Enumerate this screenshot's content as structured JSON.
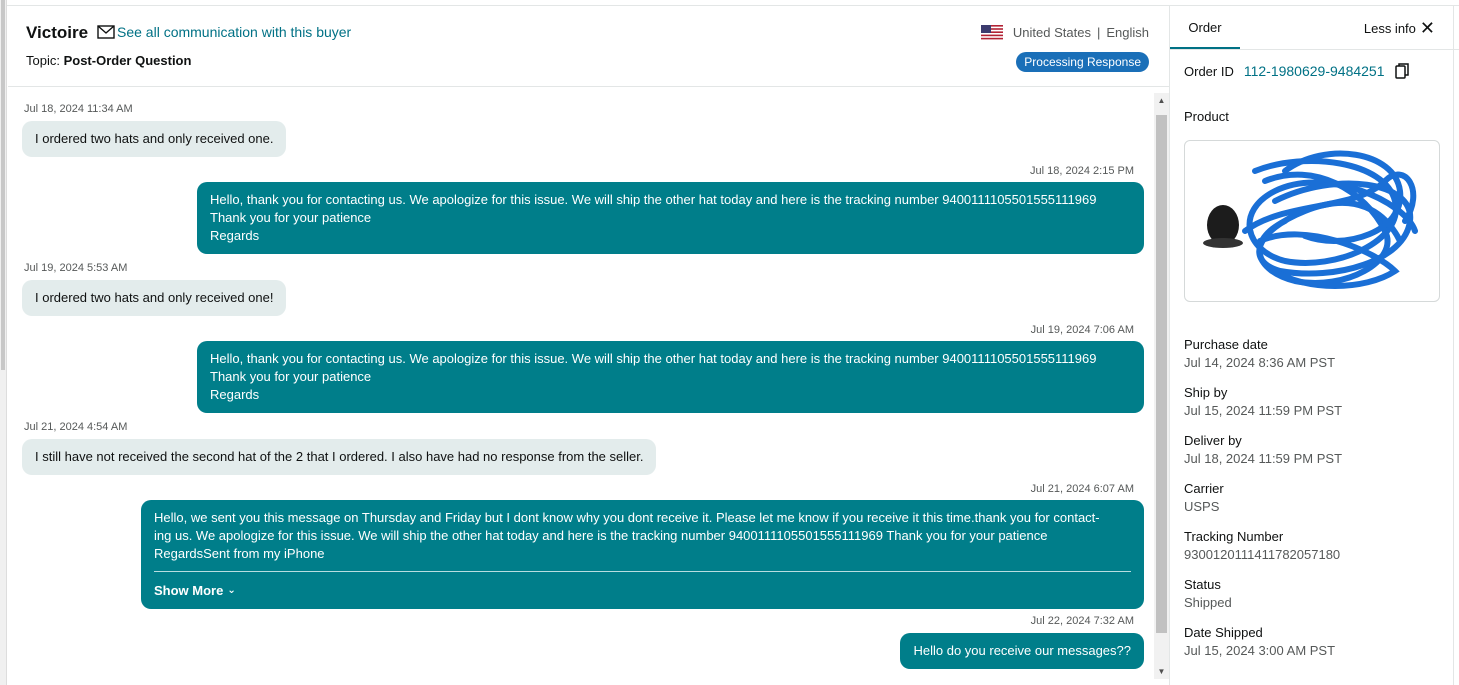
{
  "header": {
    "buyer_name": "Victoire",
    "see_all_link": "See all communication with this buyer",
    "country": "United States",
    "separator": "|",
    "language": "English",
    "topic_label": "Topic:",
    "topic_value": "Post-Order Question",
    "status_badge": "Processing Response"
  },
  "messages": [
    {
      "time": "Jul 18, 2024 11:34 AM",
      "dir": "in",
      "lines": [
        "I ordered two hats and only received one."
      ]
    },
    {
      "time": "Jul 18, 2024 2:15 PM",
      "dir": "out",
      "lines": [
        "Hello, thank you for contacting us. We apologize for this issue. We will ship the other hat today and here is the tracking number 9400111105501555111969",
        "Thank you for your patience",
        "Regards"
      ]
    },
    {
      "time": "Jul 19, 2024 5:53 AM",
      "dir": "in",
      "lines": [
        "I ordered two hats and only received one!"
      ]
    },
    {
      "time": "Jul 19, 2024 7:06 AM",
      "dir": "out",
      "lines": [
        "Hello, thank you for contacting us. We apologize for this issue. We will ship the other hat today and here is the tracking number 9400111105501555111969",
        "Thank you for your patience",
        "Regards"
      ]
    },
    {
      "time": "Jul 21, 2024 4:54 AM",
      "dir": "in",
      "lines": [
        "I still have not received the second hat of the 2 that I ordered. I also have had no response from the seller."
      ]
    },
    {
      "time": "Jul 21, 2024 6:07 AM",
      "dir": "out",
      "lines": [
        "Hello, we sent you this message on Thursday and Friday but I dont know why you dont receive it. Please let me know if you receive it this time.thank you for contact-",
        "ing us. We apologize for this issue. We will ship the other hat today and here is the tracking number 9400111105501555111969 Thank you for your patience",
        "RegardsSent from my iPhone"
      ],
      "show_more": "Show More"
    },
    {
      "time": "Jul 22, 2024 7:32 AM",
      "dir": "out",
      "lines": [
        "Hello do you receive our messages??"
      ]
    }
  ],
  "side": {
    "tab_order": "Order",
    "less_info": "Less info",
    "order_id_label": "Order ID",
    "order_id": "112-1980629-9484251",
    "product_label": "Product",
    "fields": [
      {
        "key": "Purchase date",
        "value": "Jul 14, 2024 8:36 AM PST"
      },
      {
        "key": "Ship by",
        "value": "Jul 15, 2024 11:59 PM PST"
      },
      {
        "key": "Deliver by",
        "value": "Jul 18, 2024 11:59 PM PST"
      },
      {
        "key": "Carrier",
        "value": "USPS"
      },
      {
        "key": "Tracking Number",
        "value": "9300120111411782057180"
      },
      {
        "key": "Status",
        "value": "Shipped"
      },
      {
        "key": "Date Shipped",
        "value": "Jul 15, 2024 3:00 AM PST"
      }
    ]
  },
  "colors": {
    "accent_link": "#007185",
    "outgoing_bubble": "#007e8a",
    "incoming_bubble": "#e3ecec",
    "badge": "#1a6fb8",
    "redaction": "#1a6fd6"
  },
  "icons": {
    "mail": "mail-icon",
    "flag": "us-flag-icon",
    "copy": "copy-icon",
    "close": "close-icon",
    "chevron": "chevron-down-icon"
  }
}
